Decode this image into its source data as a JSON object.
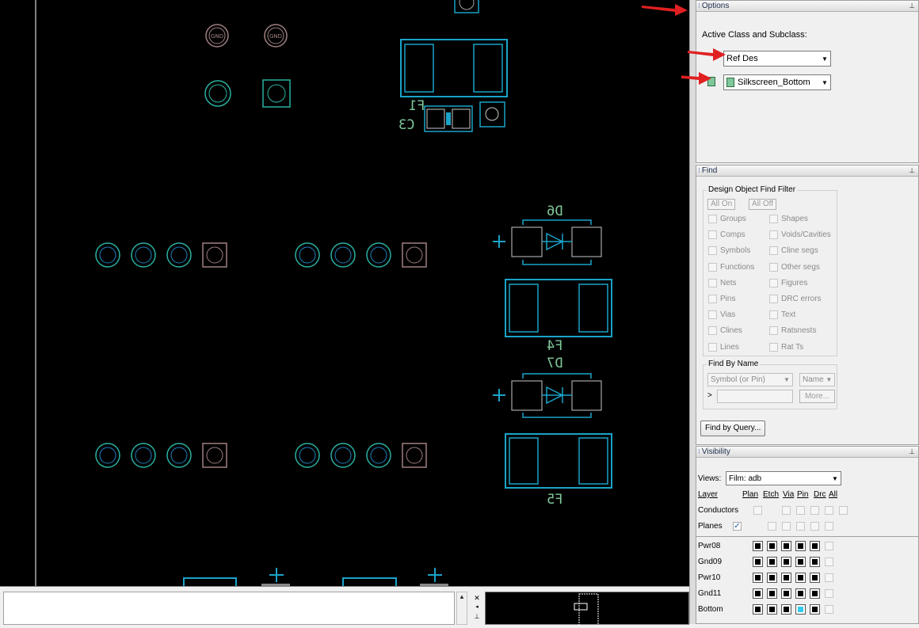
{
  "canvas": {
    "refdes": [
      "F1",
      "C3",
      "D6",
      "F4",
      "D7",
      "F5"
    ],
    "pad_labels": [
      "GND",
      "GND"
    ]
  },
  "options": {
    "title": "Options",
    "active_label": "Active Class and Subclass:",
    "class_value": "Ref Des",
    "subclass_value": "Silkscreen_Bottom",
    "colors": {
      "silkscreen": "#7ec89a",
      "arrow": "#e02020"
    }
  },
  "find": {
    "title": "Find",
    "filter_title": "Design Object Find Filter",
    "all_on": "All On",
    "all_off": "All Off",
    "items_left": [
      "Groups",
      "Comps",
      "Symbols",
      "Functions",
      "Nets",
      "Pins",
      "Vias",
      "Clines",
      "Lines"
    ],
    "items_right": [
      "Shapes",
      "Voids/Cavities",
      "Cline segs",
      "Other segs",
      "Figures",
      "DRC errors",
      "Text",
      "Ratsnests",
      "Rat Ts"
    ],
    "by_name_title": "Find By Name",
    "by_name_type": "Symbol (or Pin)",
    "by_name_mode": "Name",
    "by_name_prompt": ">",
    "more": "More...",
    "query": "Find by Query..."
  },
  "visibility": {
    "title": "Visibility",
    "views_label": "Views:",
    "views_value": "Film: adb",
    "layer_label": "Layer",
    "columns": [
      "Plan",
      "Etch",
      "Via",
      "Pin",
      "Drc",
      "All"
    ],
    "conductors": "Conductors",
    "planes": "Planes",
    "layers": [
      "Pwr08",
      "Gnd09",
      "Pwr10",
      "Gnd11",
      "Bottom"
    ]
  }
}
